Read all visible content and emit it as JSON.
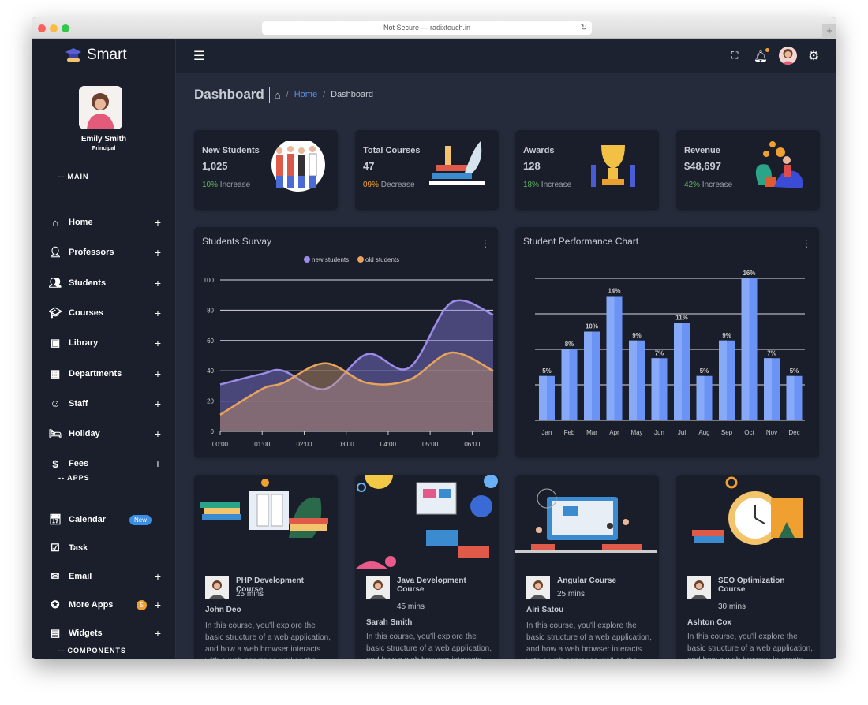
{
  "browser": {
    "url": "Not Secure — radixtouch.in"
  },
  "sidebar": {
    "brand": "Smart",
    "user": {
      "name": "Emily Smith",
      "role": "Principal"
    },
    "sections": [
      {
        "label": "-- MAIN"
      },
      {
        "label": "-- APPS"
      },
      {
        "label": "-- COMPONENTS"
      }
    ],
    "main_items": [
      {
        "label": "Home",
        "icon": "home-icon"
      },
      {
        "label": "Professors",
        "icon": "person-icon"
      },
      {
        "label": "Students",
        "icon": "people-icon"
      },
      {
        "label": "Courses",
        "icon": "graduation-cap-icon"
      },
      {
        "label": "Library",
        "icon": "library-icon"
      },
      {
        "label": "Departments",
        "icon": "building-icon"
      },
      {
        "label": "Staff",
        "icon": "face-icon"
      },
      {
        "label": "Holiday",
        "icon": "bed-icon"
      },
      {
        "label": "Fees",
        "icon": "dollar-icon"
      }
    ],
    "app_items": [
      {
        "label": "Calendar",
        "badge": "New"
      },
      {
        "label": "Task"
      },
      {
        "label": "Email"
      },
      {
        "label": "More Apps",
        "badge": "5"
      },
      {
        "label": "Widgets"
      }
    ]
  },
  "breadcrumb": {
    "title": "Dashboard",
    "home": "Home",
    "current": "Dashboard"
  },
  "stats": [
    {
      "title": "New Students",
      "value": "1,025",
      "change": "10%",
      "change_text": "Increase",
      "color": "#5cb85c"
    },
    {
      "title": "Total Courses",
      "value": "47",
      "change": "09%",
      "change_text": "Decrease",
      "color": "#f0a030"
    },
    {
      "title": "Awards",
      "value": "128",
      "change": "18%",
      "change_text": "Increase",
      "color": "#5cb85c"
    },
    {
      "title": "Revenue",
      "value": "$48,697",
      "change": "42%",
      "change_text": "Increase",
      "color": "#5cb85c"
    }
  ],
  "chart_data": [
    {
      "type": "area",
      "title": "Students Survay",
      "ylim": [
        0,
        100
      ],
      "yticks": [
        "0",
        "20",
        "40",
        "60",
        "80",
        "100"
      ],
      "xticks": [
        "00:00",
        "01:00",
        "02:00",
        "03:00",
        "04:00",
        "05:00",
        "06:00"
      ],
      "legend": "top",
      "grid": true,
      "series": [
        {
          "name": "new students",
          "color": "#9b8ce8",
          "points": [
            [
              0,
              31
            ],
            [
              1,
              38
            ],
            [
              1.5,
              40
            ],
            [
              2.5,
              28
            ],
            [
              3.5,
              51
            ],
            [
              4.5,
              42
            ],
            [
              5.5,
              85
            ],
            [
              6.5,
              77
            ]
          ]
        },
        {
          "name": "old students",
          "color": "#e8a45c",
          "points": [
            [
              0,
              11
            ],
            [
              1,
              28
            ],
            [
              1.5,
              32
            ],
            [
              2.5,
              45
            ],
            [
              3.5,
              32
            ],
            [
              4.5,
              34
            ],
            [
              5.5,
              52
            ],
            [
              6.5,
              40
            ]
          ]
        }
      ]
    },
    {
      "type": "bar",
      "title": "Student Performance Chart",
      "ylim": [
        0,
        16
      ],
      "grid": true,
      "color": "#6b93f5",
      "categories": [
        "Jan",
        "Feb",
        "Mar",
        "Apr",
        "May",
        "Jun",
        "Jul",
        "Aug",
        "Sep",
        "Oct",
        "Nov",
        "Dec"
      ],
      "values": [
        5,
        8,
        10,
        14,
        9,
        7,
        11,
        5,
        9,
        16,
        7,
        5
      ],
      "labels": [
        "5%",
        "8%",
        "10%",
        "14%",
        "9%",
        "7%",
        "11%",
        "5%",
        "9%",
        "16%",
        "7%",
        "5%"
      ]
    }
  ],
  "courses": [
    {
      "title": "PHP Development Course",
      "duration": "25 mins",
      "author": "John Deo",
      "desc": "In this course, you'll explore the basic structure of a web application, and how a web browser interacts with a web server,as well as the basic syntax"
    },
    {
      "title": "Java Development Course",
      "duration": "45 mins",
      "author": "Sarah Smith",
      "desc": "In this course, you'll explore the basic structure of a web application, and how a web browser interacts with a web"
    },
    {
      "title": "Angular Course",
      "duration": "25 mins",
      "author": "Airi Satou",
      "desc": "In this course, you'll explore the basic structure of a web application, and how a web browser interacts with a web server,as well as the basic syntax"
    },
    {
      "title": "SEO Optimization Course",
      "duration": "30 mins",
      "author": "Ashton Cox",
      "desc": "In this course, you'll explore the basic structure of a web application, and how a web browser interacts with a web server,as well as the basic syntax"
    }
  ]
}
